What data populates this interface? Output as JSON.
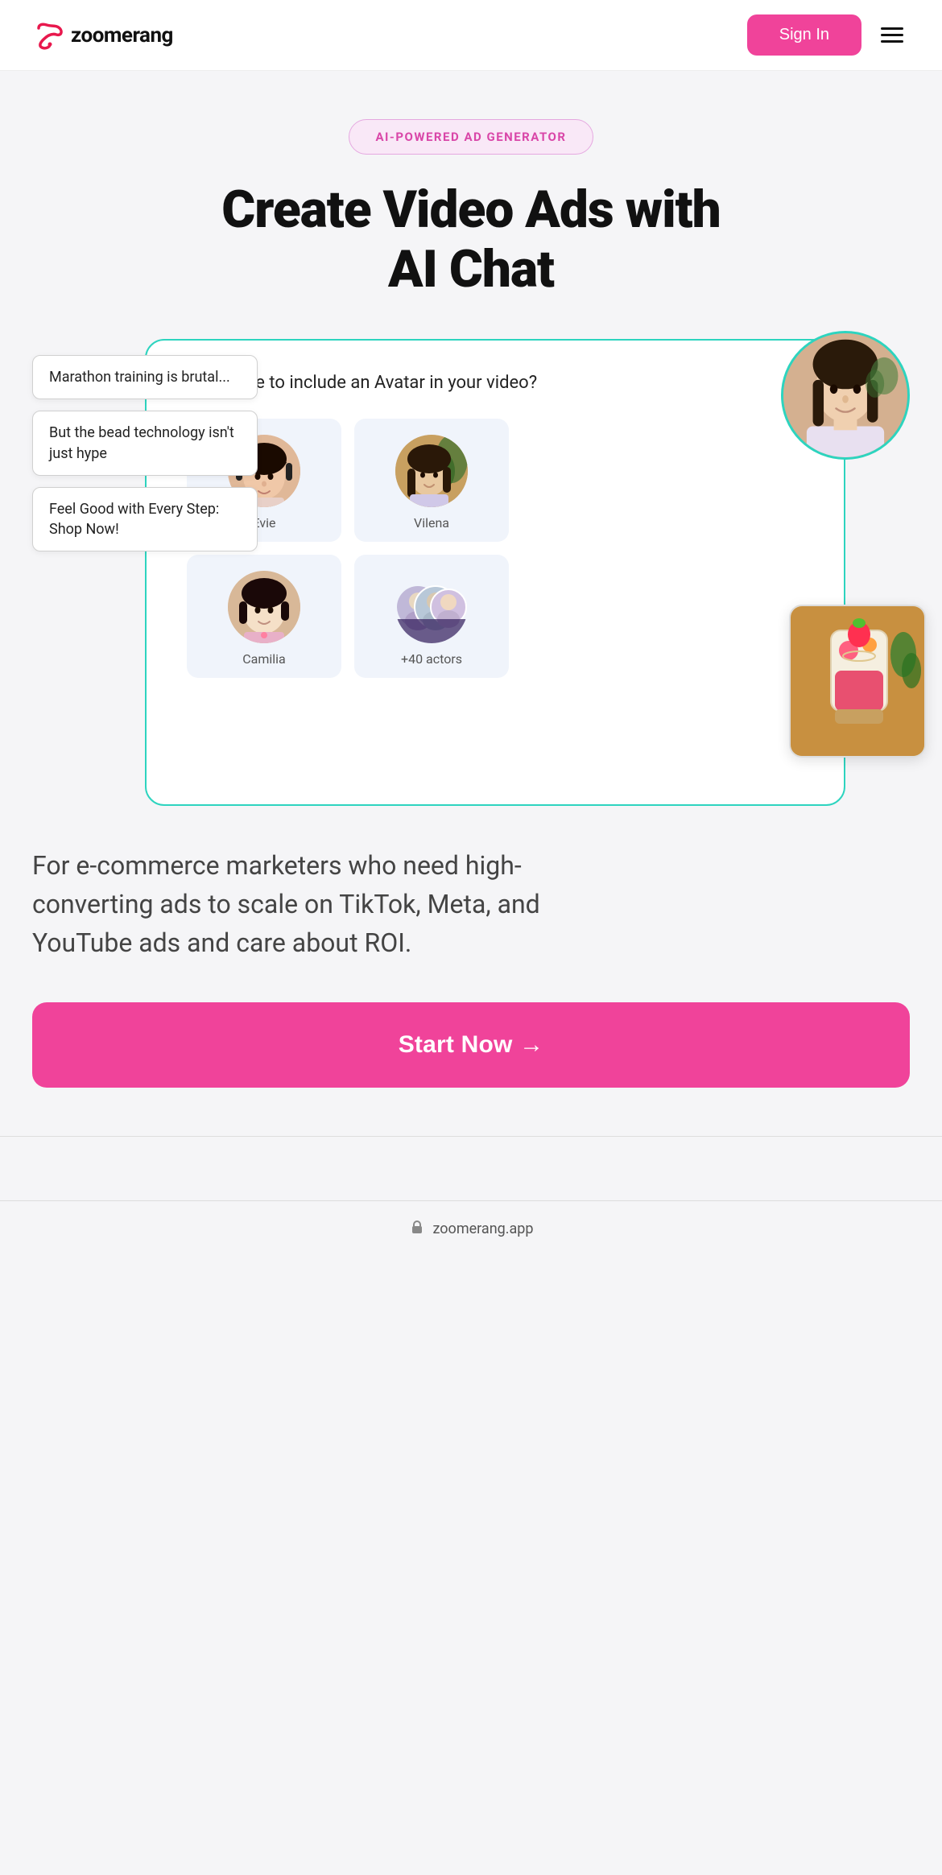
{
  "header": {
    "logo_text": "zoomerang",
    "sign_in_label": "Sign In",
    "menu_icon": "hamburger"
  },
  "hero": {
    "badge_text": "AI-POWERED AD GENERATOR",
    "title_line1": "Create Video Ads with",
    "title_line2": "AI Chat"
  },
  "chat_bubbles": [
    {
      "text": "Marathon training is brutal..."
    },
    {
      "text": "But the bead technology isn't just hype"
    },
    {
      "text": "Feel Good with Every Step: Shop Now!"
    }
  ],
  "ui_card": {
    "question": "ld you like to include an Avatar in your video?"
  },
  "actors": [
    {
      "name": "Evie",
      "type": "evie"
    },
    {
      "name": "Vilena",
      "type": "vilena"
    },
    {
      "name": "Camilia",
      "type": "camilia"
    },
    {
      "name": "+40 actors",
      "type": "more"
    }
  ],
  "tagline": "For e-commerce marketers who need high-converting ads to scale on TikTok, Meta, and YouTube ads and care about ROI.",
  "cta": {
    "label": "Start Now →"
  },
  "footer": {
    "lock_icon": "lock",
    "url": "zoomerang.app"
  }
}
